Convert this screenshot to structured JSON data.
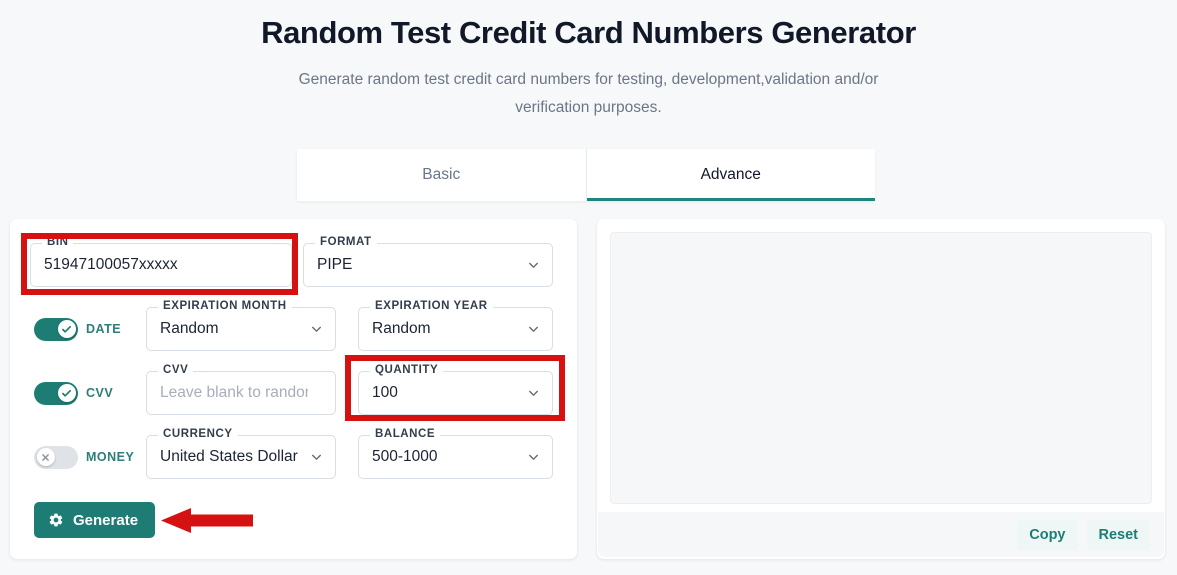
{
  "header": {
    "title": "Random Test Credit Card Numbers Generator",
    "subtitle": "Generate random test credit card numbers for testing, development,validation and/or verification purposes."
  },
  "tabs": [
    {
      "label": "Basic",
      "active": false
    },
    {
      "label": "Advance",
      "active": true
    }
  ],
  "form": {
    "bin": {
      "legend": "BIN",
      "value": "51947100057xxxxx"
    },
    "format": {
      "legend": "FORMAT",
      "value": "PIPE"
    },
    "expiration_month": {
      "legend": "EXPIRATION MONTH",
      "value": "Random"
    },
    "expiration_year": {
      "legend": "EXPIRATION YEAR",
      "value": "Random"
    },
    "cvv": {
      "legend": "CVV",
      "placeholder": "Leave blank to randomize",
      "value": ""
    },
    "quantity": {
      "legend": "QUANTITY",
      "value": "100"
    },
    "currency": {
      "legend": "CURRENCY",
      "value": "United States Dollar"
    },
    "balance": {
      "legend": "BALANCE",
      "value": "500-1000"
    },
    "toggles": [
      {
        "label": "DATE",
        "state": "on"
      },
      {
        "label": "CVV",
        "state": "on"
      },
      {
        "label": "MONEY",
        "state": "off"
      }
    ],
    "generate_label": "Generate"
  },
  "output": {
    "value": "",
    "placeholder": "",
    "copy_label": "Copy",
    "reset_label": "Reset"
  },
  "colors": {
    "accent": "#1d7d74",
    "annotation": "#d51111",
    "page_bg": "#f7f8fa",
    "toggle_off": "#dfe3e8"
  },
  "icons": {
    "chevron_down": "chevron-down-icon",
    "gear": "gear-icon",
    "check": "check-icon",
    "cross": "cross-icon",
    "arrow_left": "arrow-left-icon"
  }
}
